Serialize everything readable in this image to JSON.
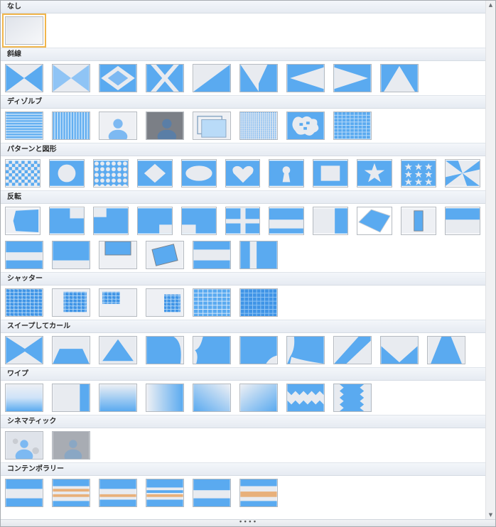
{
  "sections": [
    {
      "label": "なし",
      "tiles": [
        "none"
      ]
    },
    {
      "label": "斜線",
      "tiles": [
        "diag-1",
        "diag-2",
        "diag-3",
        "diag-4",
        "diag-5",
        "diag-6",
        "diag-7",
        "diag-8",
        "diag-9"
      ]
    },
    {
      "label": "ディゾルブ",
      "tiles": [
        "diss-1",
        "diss-2",
        "diss-3",
        "diss-4",
        "diss-5",
        "diss-6",
        "diss-7",
        "diss-8"
      ]
    },
    {
      "label": "パターンと図形",
      "tiles": [
        "pat-1",
        "pat-2",
        "pat-3",
        "pat-4",
        "pat-5",
        "pat-6",
        "pat-7",
        "pat-8",
        "pat-9",
        "pat-10",
        "pat-11"
      ]
    },
    {
      "label": "反転",
      "tiles": [
        "flip-1",
        "flip-2",
        "flip-3",
        "flip-4",
        "flip-5",
        "flip-6",
        "flip-7",
        "flip-8",
        "flip-9",
        "flip-10",
        "flip-11",
        "flip-12",
        "flip-13",
        "flip-14",
        "flip-15",
        "flip-16",
        "flip-17"
      ]
    },
    {
      "label": "シャッター",
      "tiles": [
        "shut-1",
        "shut-2",
        "shut-3",
        "shut-4",
        "shut-5",
        "shut-6"
      ]
    },
    {
      "label": "スイープしてカール",
      "tiles": [
        "sweep-1",
        "sweep-2",
        "sweep-3",
        "sweep-4",
        "sweep-5",
        "sweep-6",
        "sweep-7",
        "sweep-8",
        "sweep-9",
        "sweep-10",
        "sweep-11"
      ]
    },
    {
      "label": "ワイプ",
      "tiles": [
        "wipe-1",
        "wipe-2",
        "wipe-3",
        "wipe-4",
        "wipe-5",
        "wipe-6",
        "wipe-7",
        "wipe-8"
      ]
    },
    {
      "label": "シネマティック",
      "tiles": [
        "cine-1",
        "cine-2"
      ]
    },
    {
      "label": "コンテンポラリー",
      "tiles": [
        "cont-1",
        "cont-2",
        "cont-3",
        "cont-4",
        "cont-5",
        "cont-6"
      ]
    }
  ],
  "selected_tile": "none",
  "grip_text": "∙∙∙∙",
  "scroll": {
    "up": "▲",
    "down": "▼"
  },
  "colors": {
    "tile_blue": "#5aaaf0",
    "tile_light": "#eef0f4",
    "selected_border": "#f0b54b",
    "section_header": "#e6ebf2"
  }
}
